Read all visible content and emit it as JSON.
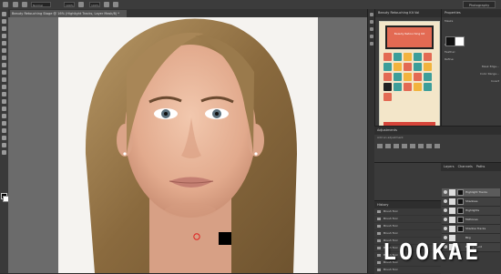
{
  "options_bar": {
    "mode_label": "Normal",
    "opacity_label": "100%",
    "flow_label": "100%",
    "workspace_label": "Photography"
  },
  "document": {
    "tab_title": "Beauty Retouching Stage @ 16% (Highlight Tracks, Layer Mask/8) *"
  },
  "preview_panel": {
    "title": "Beauty Retouching Kit Vol"
  },
  "poster": {
    "title": "Beauty Retouching Kit"
  },
  "properties_panel": {
    "title": "Properties",
    "mask_label": "Masks",
    "density_label": "Density:",
    "feather_label": "Feather:",
    "refine_label": "Refine:",
    "mask_edge_label": "Mask Edge...",
    "color_range_label": "Color Range...",
    "invert_label": "Invert"
  },
  "adjustments_panel": {
    "title": "Adjustments",
    "subtitle": "Add an adjustment"
  },
  "history_panel": {
    "title": "History",
    "items": [
      "Brush Tool",
      "Brush Tool",
      "Brush Tool",
      "Brush Tool",
      "Brush Tool",
      "Brush Tool",
      "Brush Tool",
      "Brush Tool",
      "Brush Tool"
    ]
  },
  "layers_panel": {
    "tabs": [
      "Layers",
      "Channels",
      "Paths"
    ],
    "layers": [
      "Highlight Tracks",
      "Shadows",
      "Highlights",
      "Midtones",
      "Shadow Tracks",
      "Bkg",
      "Background"
    ]
  },
  "watermark": "LOOKAE",
  "colors": {
    "app_bg": "#2b2b2b",
    "panel_bg": "#3a3a3a",
    "canvas_bg": "#6b6b6b",
    "poster_red": "#e36a53",
    "poster_teal": "#3c9e9a",
    "poster_cream": "#f3e6c9"
  }
}
